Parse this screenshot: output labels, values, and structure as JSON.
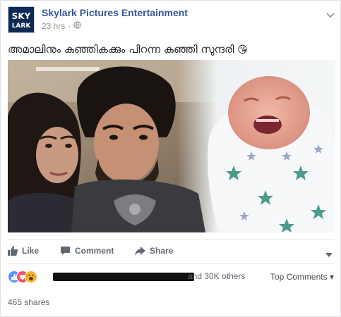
{
  "post": {
    "page_name": "Skylark Pictures Entertainment",
    "avatar_text_top": "SKY",
    "avatar_text_bottom": "LARK",
    "time": "23 hrs",
    "separator": "·",
    "text": "അമാലിനും കുഞ്ഞികക്കും പിറന്ന കുഞ്ഞി സുന്ദരി",
    "emoji": "😘"
  },
  "actions": {
    "like": "Like",
    "comment": "Comment",
    "share": "Share"
  },
  "reactions": {
    "others_text": "and 30K others",
    "top_comments": "Top Comments",
    "icons": [
      "like-icon",
      "love-icon",
      "haha-icon"
    ]
  },
  "shares": "465 shares",
  "colors": {
    "link": "#365899",
    "meta": "#90949c",
    "action": "#616770",
    "like_blue": "#5890ff",
    "love_red": "#f25268",
    "haha_yellow": "#f7b125"
  }
}
